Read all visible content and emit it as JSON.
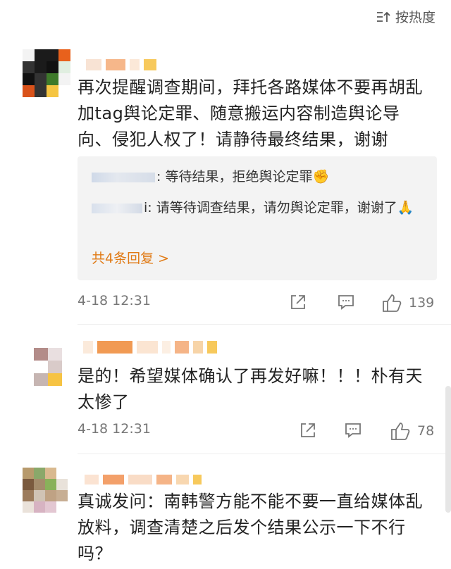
{
  "header": {
    "sort_label": "按热度"
  },
  "comments": [
    {
      "text": "再次提醒调查期间，拜托各路媒体不要再胡乱加tag舆论定罪、随意搬运内容制造舆论导向、侵犯人权了！请静待最终结果，谢谢",
      "replies": [
        {
          "text": ": 等待结果，拒绝舆论定罪",
          "emoji": "✊"
        },
        {
          "text": "i: 请等待调查结果，请勿舆论定罪，谢谢了",
          "emoji": "🙏"
        }
      ],
      "more_replies": "共4条回复 >",
      "time": "4-18 12:31",
      "likes": "139"
    },
    {
      "text": "是的！希望媒体确认了再发好嘛！！！朴有天太惨了",
      "time": "4-18 12:31",
      "likes": "78"
    },
    {
      "text": "真诚发问：南韩警方能不能不要一直给媒体乱放料，调查清楚之后发个结果公示一下不行吗？"
    }
  ],
  "colors": {
    "accent": "#e07a15",
    "meta": "#777777",
    "reply_bg": "#f3f3f3"
  }
}
